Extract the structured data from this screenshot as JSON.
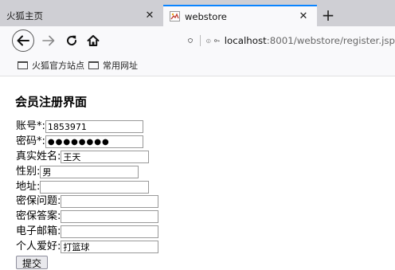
{
  "browser": {
    "tabs": [
      {
        "title": "火狐主页",
        "active": false
      },
      {
        "title": "webstore",
        "active": true
      }
    ],
    "close_glyph": "✕",
    "new_tab_glyph": "+",
    "url": {
      "host": "localhost",
      "rest": ":8001/webstore/register.jsp"
    },
    "bookmarks": [
      {
        "label": "火狐官方站点"
      },
      {
        "label": "常用网址"
      }
    ],
    "icons": {
      "back": "back-arrow-icon",
      "forward": "forward-arrow-icon",
      "reload": "reload-icon",
      "home": "home-icon"
    }
  },
  "page": {
    "title": "会员注册界面",
    "fields": [
      {
        "label": "账号*:",
        "value": "1853971"
      },
      {
        "label": "密码*:",
        "value": "●●●●●●●●"
      },
      {
        "label": "真实姓名:",
        "value": "王天"
      },
      {
        "label": "性别:",
        "value": "男"
      },
      {
        "label": "地址:",
        "value": ""
      },
      {
        "label": "密保问题:",
        "value": ""
      },
      {
        "label": "密保答案:",
        "value": ""
      },
      {
        "label": "电子邮箱:",
        "value": ""
      },
      {
        "label": "个人爱好:",
        "value": "打篮球"
      }
    ],
    "submit_label": "提交"
  }
}
